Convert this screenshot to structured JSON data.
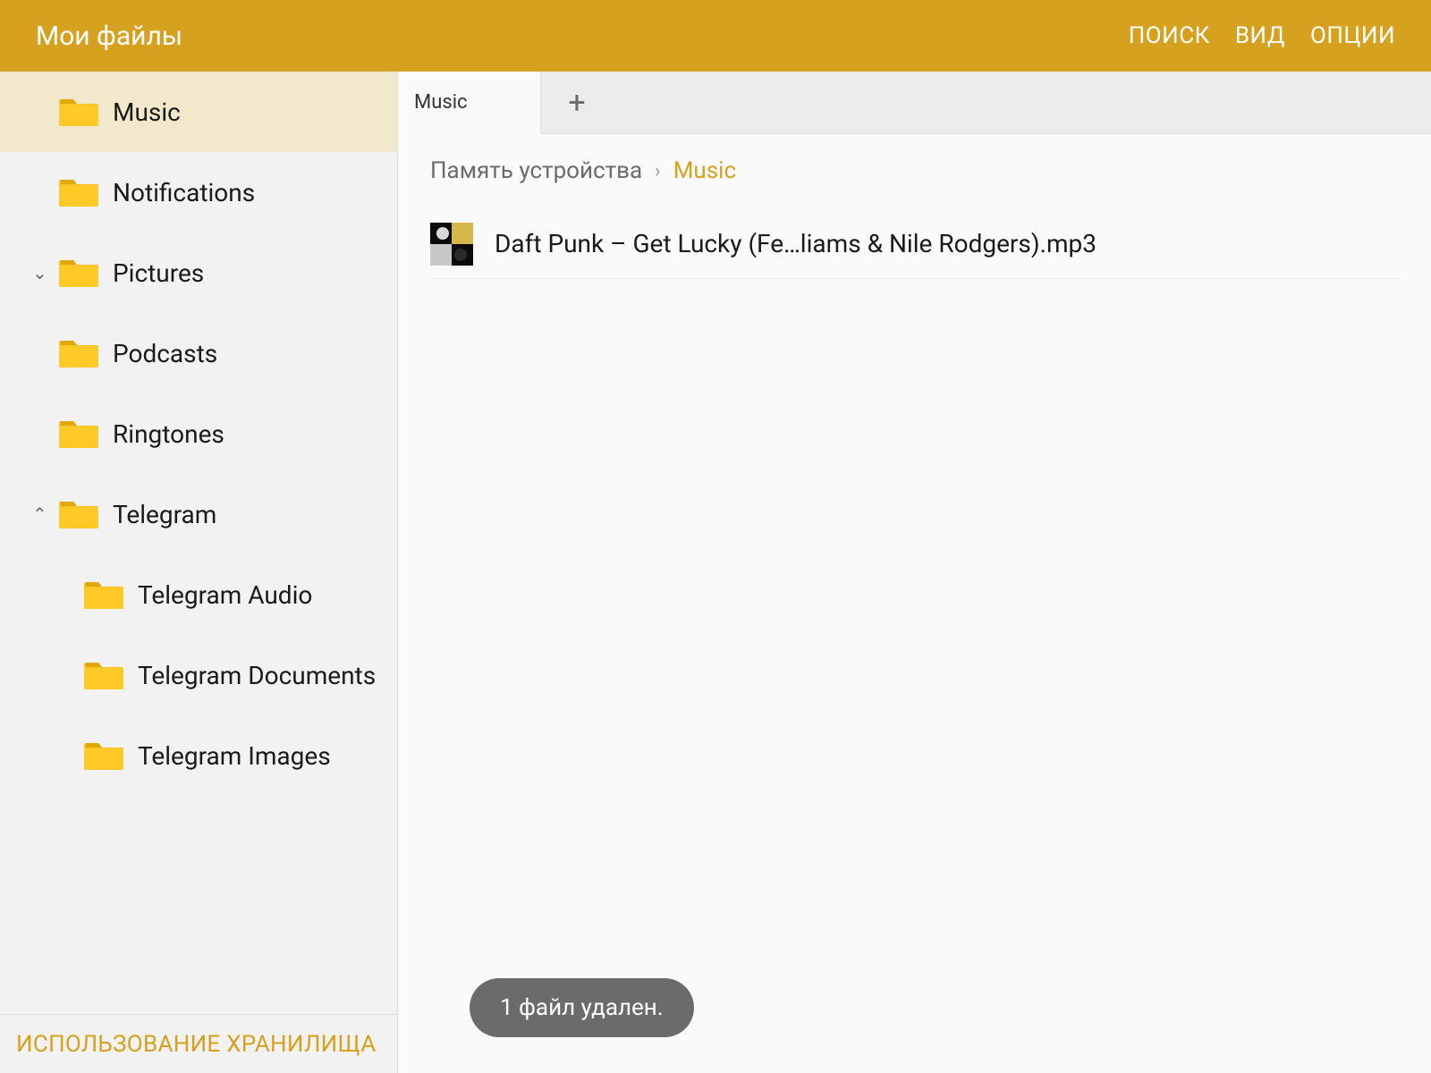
{
  "header": {
    "title": "Мои файлы",
    "actions": {
      "search": "ПОИСК",
      "view": "ВИД",
      "options": "ОПЦИИ"
    }
  },
  "sidebar": {
    "items": [
      {
        "label": "Music",
        "selected": true,
        "expandable": false,
        "expanded": false,
        "level": 0
      },
      {
        "label": "Notifications",
        "selected": false,
        "expandable": false,
        "expanded": false,
        "level": 0
      },
      {
        "label": "Pictures",
        "selected": false,
        "expandable": true,
        "expanded": false,
        "level": 0
      },
      {
        "label": "Podcasts",
        "selected": false,
        "expandable": false,
        "expanded": false,
        "level": 0
      },
      {
        "label": "Ringtones",
        "selected": false,
        "expandable": false,
        "expanded": false,
        "level": 0
      },
      {
        "label": "Telegram",
        "selected": false,
        "expandable": true,
        "expanded": true,
        "level": 0
      },
      {
        "label": "Telegram Audio",
        "selected": false,
        "expandable": false,
        "expanded": false,
        "level": 1
      },
      {
        "label": "Telegram Documents",
        "selected": false,
        "expandable": false,
        "expanded": false,
        "level": 1
      },
      {
        "label": "Telegram Images",
        "selected": false,
        "expandable": false,
        "expanded": false,
        "level": 1
      }
    ],
    "footer": "ИСПОЛЬЗОВАНИЕ ХРАНИЛИЩА"
  },
  "tabs": {
    "active": "Music",
    "add_icon": "plus-icon"
  },
  "breadcrumb": {
    "parent": "Память устройства",
    "current": "Music"
  },
  "files": [
    {
      "name": "Daft Punk – Get Lucky (Fe…liams & Nile Rodgers).mp3"
    }
  ],
  "toast": "1 файл удален.",
  "colors": {
    "accent": "#d6a11e"
  }
}
